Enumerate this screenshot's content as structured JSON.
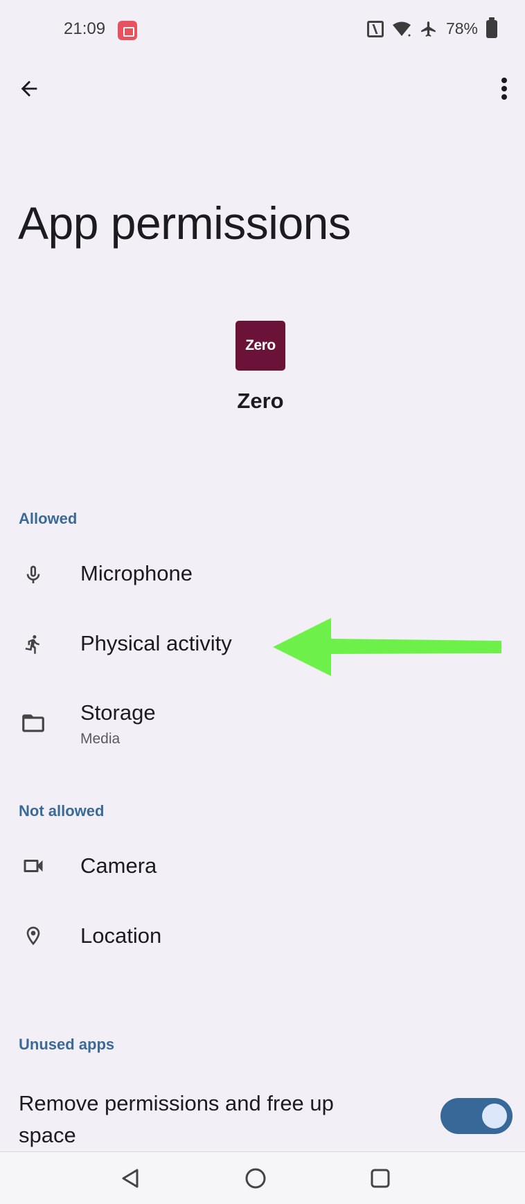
{
  "status_bar": {
    "time": "21:09",
    "battery": "78%",
    "icons": [
      "screen-record-icon",
      "nfc-icon",
      "wifi-icon",
      "airplane-icon",
      "battery-icon"
    ]
  },
  "toolbar": {
    "back_icon": "arrow-back-icon",
    "more_icon": "more-vert-icon"
  },
  "page": {
    "title": "App permissions"
  },
  "app": {
    "icon_text": "Zero",
    "name": "Zero",
    "icon_color": "#6b1239"
  },
  "sections": {
    "allowed": {
      "header": "Allowed",
      "items": [
        {
          "label": "Microphone",
          "icon": "microphone-icon"
        },
        {
          "label": "Physical activity",
          "icon": "running-person-icon"
        },
        {
          "label": "Storage",
          "sub": "Media",
          "icon": "folder-icon"
        }
      ]
    },
    "not_allowed": {
      "header": "Not allowed",
      "items": [
        {
          "label": "Camera",
          "icon": "videocam-icon"
        },
        {
          "label": "Location",
          "icon": "location-pin-icon"
        }
      ]
    },
    "unused_apps": {
      "header": "Unused apps",
      "toggle_label": "Remove permissions and free up space",
      "toggle_on": true
    }
  },
  "colors": {
    "background": "#f2f0f6",
    "section_header": "#3c6a97",
    "toggle_track": "#386898",
    "annotation_arrow": "#6ef04a"
  },
  "nav_bar": {
    "icons": [
      "nav-back-icon",
      "nav-home-icon",
      "nav-recents-icon"
    ]
  }
}
